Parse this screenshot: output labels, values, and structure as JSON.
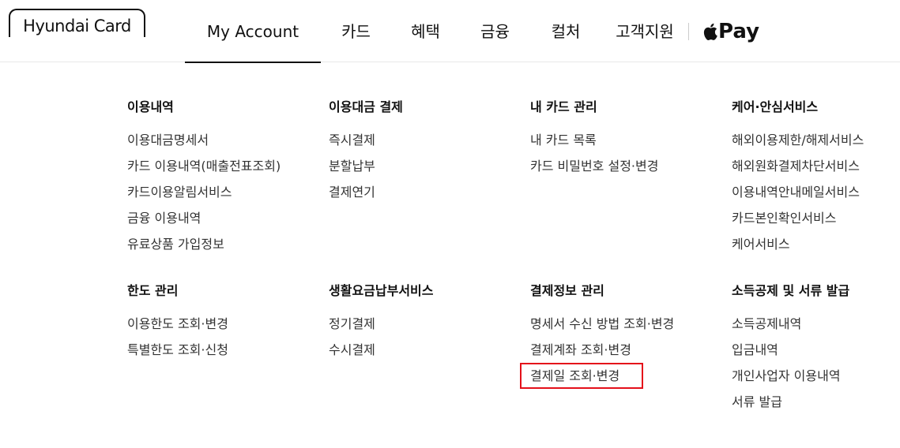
{
  "header": {
    "logo_text": "Hyundai Card",
    "nav": [
      {
        "label": "My Account"
      },
      {
        "label": "카드"
      },
      {
        "label": "혜택"
      },
      {
        "label": "금융"
      },
      {
        "label": "컬처"
      },
      {
        "label": "고객지원"
      }
    ],
    "apple_pay_label": "Pay"
  },
  "menu": {
    "col1": [
      {
        "title": "이용내역",
        "items": [
          "이용대금명세서",
          "카드 이용내역(매출전표조회)",
          "카드이용알림서비스",
          "금융 이용내역",
          "유료상품 가입정보"
        ]
      },
      {
        "title": "한도 관리",
        "items": [
          "이용한도 조회·변경",
          "특별한도 조회·신청"
        ]
      }
    ],
    "col2": [
      {
        "title": "이용대금 결제",
        "items": [
          "즉시결제",
          "분할납부",
          "결제연기"
        ]
      },
      {
        "title": "생활요금납부서비스",
        "items": [
          "정기결제",
          "수시결제"
        ]
      }
    ],
    "col3": [
      {
        "title": "내 카드 관리",
        "items": [
          "내 카드 목록",
          "카드 비밀번호 설정·변경"
        ]
      },
      {
        "title": "결제정보 관리",
        "items": [
          "명세서 수신 방법 조회·변경",
          "결제계좌 조회·변경",
          "결제일 조회·변경"
        ]
      }
    ],
    "col4": [
      {
        "title": "케어·안심서비스",
        "items": [
          "해외이용제한/해제서비스",
          "해외원화결제차단서비스",
          "이용내역안내메일서비스",
          "카드본인확인서비스",
          "케어서비스"
        ]
      },
      {
        "title": "소득공제 및 서류 발급",
        "items": [
          "소득공제내역",
          "입금내역",
          "개인사업자 이용내역",
          "서류 발급"
        ]
      }
    ]
  },
  "colors": {
    "highlight": "#e4101a",
    "text": "#111111",
    "subtext": "#333333"
  }
}
